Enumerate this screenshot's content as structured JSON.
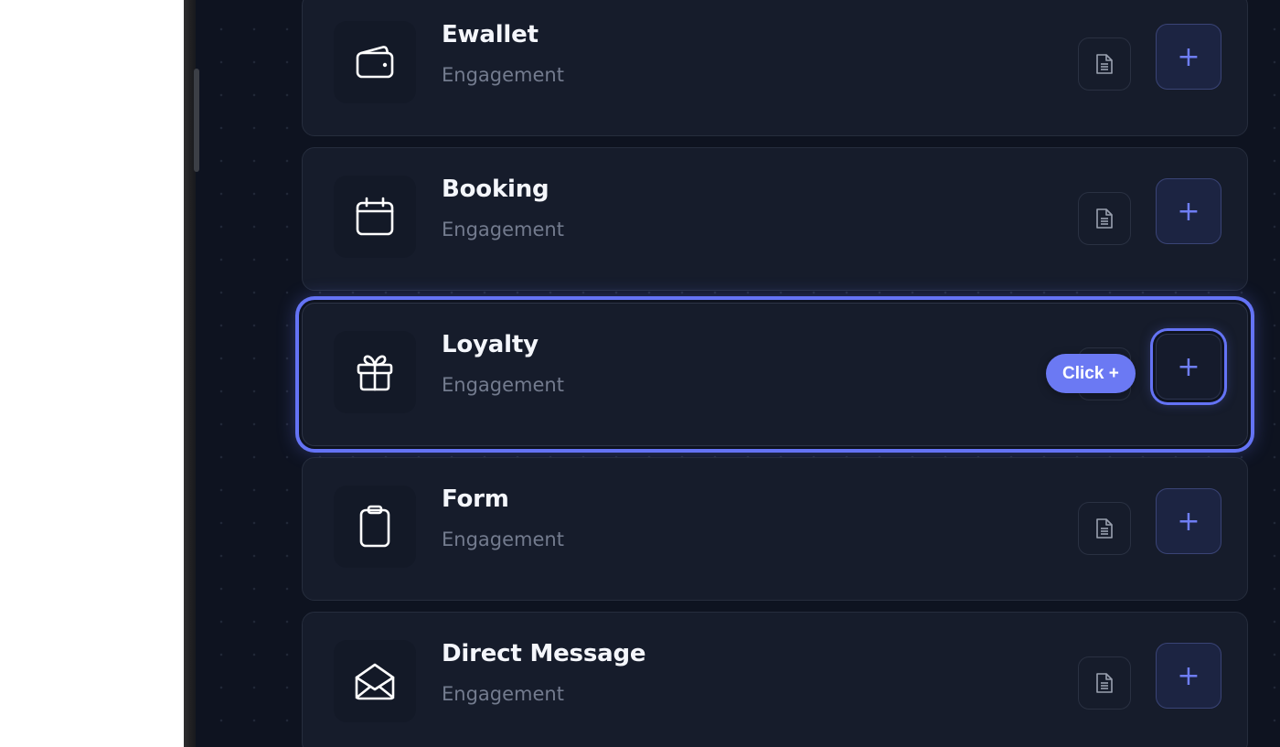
{
  "colors": {
    "panel_background": "#0e1320",
    "card_background": "#161c2b",
    "accent": "#6473f5",
    "title_text": "#f4f6fb",
    "subtitle_text": "#737b8e"
  },
  "cards": [
    {
      "title": "Ewallet",
      "subtitle": "Engagement",
      "icon": "wallet-icon",
      "selected": false
    },
    {
      "title": "Booking",
      "subtitle": "Engagement",
      "icon": "calendar-icon",
      "selected": false
    },
    {
      "title": "Loyalty",
      "subtitle": "Engagement",
      "icon": "gift-icon",
      "selected": true
    },
    {
      "title": "Form",
      "subtitle": "Engagement",
      "icon": "clipboard-icon",
      "selected": false
    },
    {
      "title": "Direct Message",
      "subtitle": "Engagement",
      "icon": "envelope-open-icon",
      "selected": false
    }
  ],
  "add_button_label": "+",
  "tooltip": {
    "text": "Click +"
  }
}
